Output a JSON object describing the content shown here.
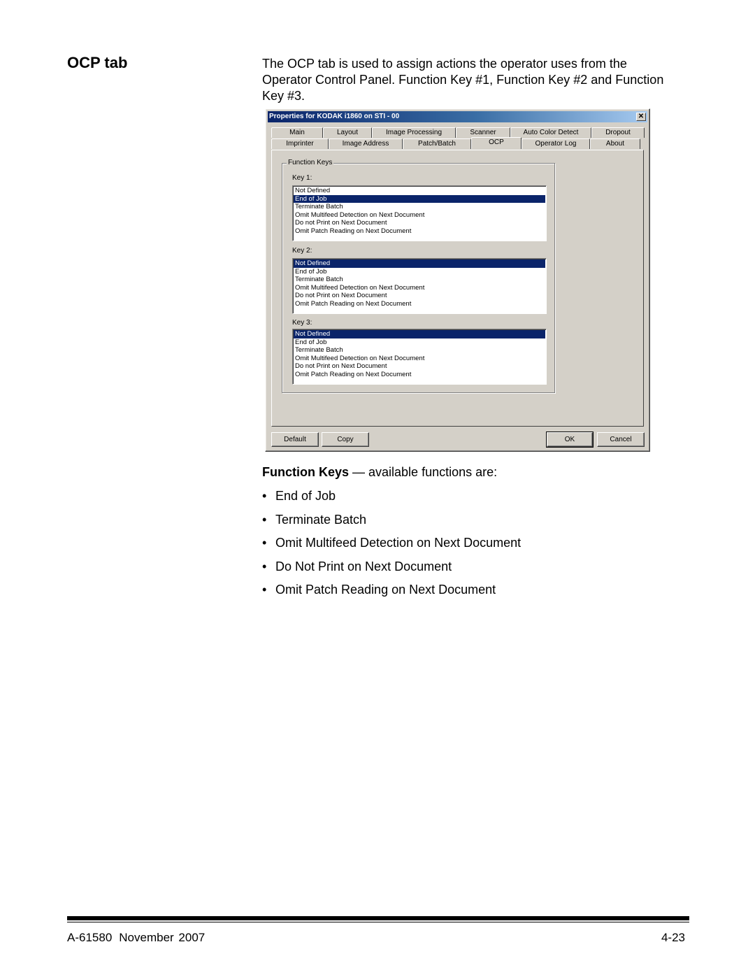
{
  "page": {
    "section_title": "OCP tab",
    "intro": "The OCP tab is used to assign actions the operator uses from the Operator Control Panel. Function Key #1, Function Key #2 and Function Key #3."
  },
  "dialog": {
    "title": "Properties for KODAK i1860 on STI - 00",
    "close_icon": "close-icon",
    "tabs_row1": [
      "Main",
      "Layout",
      "Image Processing",
      "Scanner",
      "Auto Color Detect",
      "Dropout"
    ],
    "tabs_row2": [
      "Imprinter",
      "Image Address",
      "Patch/Batch",
      "OCP",
      "Operator Log",
      "About"
    ],
    "active_tab": "OCP",
    "groupbox_label": "Function Keys",
    "keys": [
      {
        "label": "Key 1:",
        "options": [
          "Not Defined",
          "End of Job",
          "Terminate Batch",
          "Omit Multifeed Detection on Next Document",
          "Do not Print on Next Document",
          "Omit Patch Reading on Next Document"
        ],
        "selected": "End of Job"
      },
      {
        "label": "Key 2:",
        "options": [
          "Not Defined",
          "End of Job",
          "Terminate Batch",
          "Omit Multifeed Detection on Next Document",
          "Do not Print on Next Document",
          "Omit Patch Reading on Next Document"
        ],
        "selected": "Not Defined"
      },
      {
        "label": "Key 3:",
        "options": [
          "Not Defined",
          "End of Job",
          "Terminate Batch",
          "Omit Multifeed Detection on Next Document",
          "Do not Print on Next Document",
          "Omit Patch Reading on Next Document"
        ],
        "selected": "Not Defined"
      }
    ],
    "buttons": {
      "default_label": "Default",
      "copy_label": "Copy",
      "ok_label": "OK",
      "cancel_label": "Cancel"
    },
    "colors": {
      "selection": "#0a246a",
      "face": "#d4d0c8"
    }
  },
  "function_keys": {
    "heading_bold": "Function Keys",
    "heading_rest": " — available functions are:",
    "bullet_glyph": "•",
    "items": [
      "End of Job",
      "Terminate Batch",
      "Omit Multifeed Detection on Next Document",
      "Do Not Print on Next Document",
      "Omit Patch Reading on Next Document"
    ]
  },
  "footer": {
    "doc_number": "A-61580",
    "date": "November 2007",
    "page_number": "4-23"
  }
}
